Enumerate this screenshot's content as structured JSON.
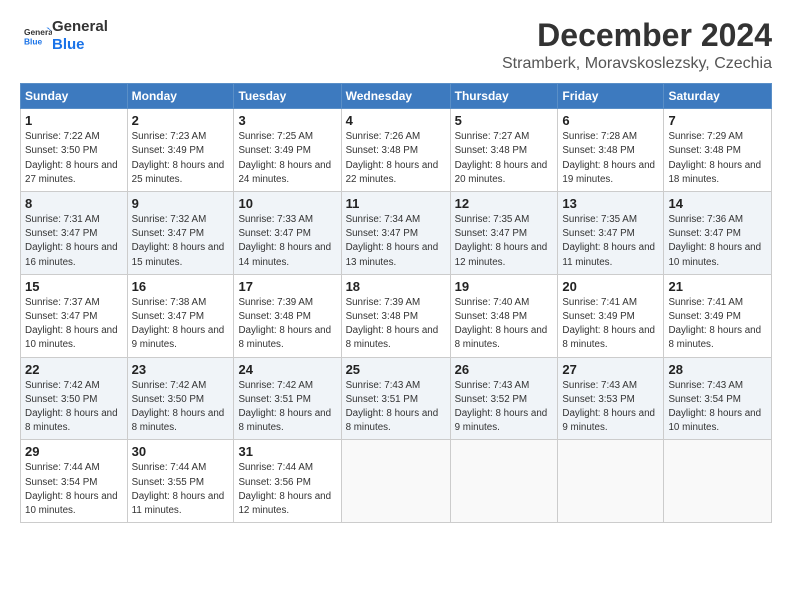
{
  "header": {
    "logo_general": "General",
    "logo_blue": "Blue",
    "month_title": "December 2024",
    "location": "Stramberk, Moravskoslezsky, Czechia"
  },
  "weekdays": [
    "Sunday",
    "Monday",
    "Tuesday",
    "Wednesday",
    "Thursday",
    "Friday",
    "Saturday"
  ],
  "weeks": [
    [
      {
        "day": "1",
        "sunrise": "7:22 AM",
        "sunset": "3:50 PM",
        "daylight": "8 hours and 27 minutes."
      },
      {
        "day": "2",
        "sunrise": "7:23 AM",
        "sunset": "3:49 PM",
        "daylight": "8 hours and 25 minutes."
      },
      {
        "day": "3",
        "sunrise": "7:25 AM",
        "sunset": "3:49 PM",
        "daylight": "8 hours and 24 minutes."
      },
      {
        "day": "4",
        "sunrise": "7:26 AM",
        "sunset": "3:48 PM",
        "daylight": "8 hours and 22 minutes."
      },
      {
        "day": "5",
        "sunrise": "7:27 AM",
        "sunset": "3:48 PM",
        "daylight": "8 hours and 20 minutes."
      },
      {
        "day": "6",
        "sunrise": "7:28 AM",
        "sunset": "3:48 PM",
        "daylight": "8 hours and 19 minutes."
      },
      {
        "day": "7",
        "sunrise": "7:29 AM",
        "sunset": "3:48 PM",
        "daylight": "8 hours and 18 minutes."
      }
    ],
    [
      {
        "day": "8",
        "sunrise": "7:31 AM",
        "sunset": "3:47 PM",
        "daylight": "8 hours and 16 minutes."
      },
      {
        "day": "9",
        "sunrise": "7:32 AM",
        "sunset": "3:47 PM",
        "daylight": "8 hours and 15 minutes."
      },
      {
        "day": "10",
        "sunrise": "7:33 AM",
        "sunset": "3:47 PM",
        "daylight": "8 hours and 14 minutes."
      },
      {
        "day": "11",
        "sunrise": "7:34 AM",
        "sunset": "3:47 PM",
        "daylight": "8 hours and 13 minutes."
      },
      {
        "day": "12",
        "sunrise": "7:35 AM",
        "sunset": "3:47 PM",
        "daylight": "8 hours and 12 minutes."
      },
      {
        "day": "13",
        "sunrise": "7:35 AM",
        "sunset": "3:47 PM",
        "daylight": "8 hours and 11 minutes."
      },
      {
        "day": "14",
        "sunrise": "7:36 AM",
        "sunset": "3:47 PM",
        "daylight": "8 hours and 10 minutes."
      }
    ],
    [
      {
        "day": "15",
        "sunrise": "7:37 AM",
        "sunset": "3:47 PM",
        "daylight": "8 hours and 10 minutes."
      },
      {
        "day": "16",
        "sunrise": "7:38 AM",
        "sunset": "3:47 PM",
        "daylight": "8 hours and 9 minutes."
      },
      {
        "day": "17",
        "sunrise": "7:39 AM",
        "sunset": "3:48 PM",
        "daylight": "8 hours and 8 minutes."
      },
      {
        "day": "18",
        "sunrise": "7:39 AM",
        "sunset": "3:48 PM",
        "daylight": "8 hours and 8 minutes."
      },
      {
        "day": "19",
        "sunrise": "7:40 AM",
        "sunset": "3:48 PM",
        "daylight": "8 hours and 8 minutes."
      },
      {
        "day": "20",
        "sunrise": "7:41 AM",
        "sunset": "3:49 PM",
        "daylight": "8 hours and 8 minutes."
      },
      {
        "day": "21",
        "sunrise": "7:41 AM",
        "sunset": "3:49 PM",
        "daylight": "8 hours and 8 minutes."
      }
    ],
    [
      {
        "day": "22",
        "sunrise": "7:42 AM",
        "sunset": "3:50 PM",
        "daylight": "8 hours and 8 minutes."
      },
      {
        "day": "23",
        "sunrise": "7:42 AM",
        "sunset": "3:50 PM",
        "daylight": "8 hours and 8 minutes."
      },
      {
        "day": "24",
        "sunrise": "7:42 AM",
        "sunset": "3:51 PM",
        "daylight": "8 hours and 8 minutes."
      },
      {
        "day": "25",
        "sunrise": "7:43 AM",
        "sunset": "3:51 PM",
        "daylight": "8 hours and 8 minutes."
      },
      {
        "day": "26",
        "sunrise": "7:43 AM",
        "sunset": "3:52 PM",
        "daylight": "8 hours and 9 minutes."
      },
      {
        "day": "27",
        "sunrise": "7:43 AM",
        "sunset": "3:53 PM",
        "daylight": "8 hours and 9 minutes."
      },
      {
        "day": "28",
        "sunrise": "7:43 AM",
        "sunset": "3:54 PM",
        "daylight": "8 hours and 10 minutes."
      }
    ],
    [
      {
        "day": "29",
        "sunrise": "7:44 AM",
        "sunset": "3:54 PM",
        "daylight": "8 hours and 10 minutes."
      },
      {
        "day": "30",
        "sunrise": "7:44 AM",
        "sunset": "3:55 PM",
        "daylight": "8 hours and 11 minutes."
      },
      {
        "day": "31",
        "sunrise": "7:44 AM",
        "sunset": "3:56 PM",
        "daylight": "8 hours and 12 minutes."
      },
      null,
      null,
      null,
      null
    ]
  ],
  "labels": {
    "sunrise": "Sunrise:",
    "sunset": "Sunset:",
    "daylight": "Daylight:"
  }
}
